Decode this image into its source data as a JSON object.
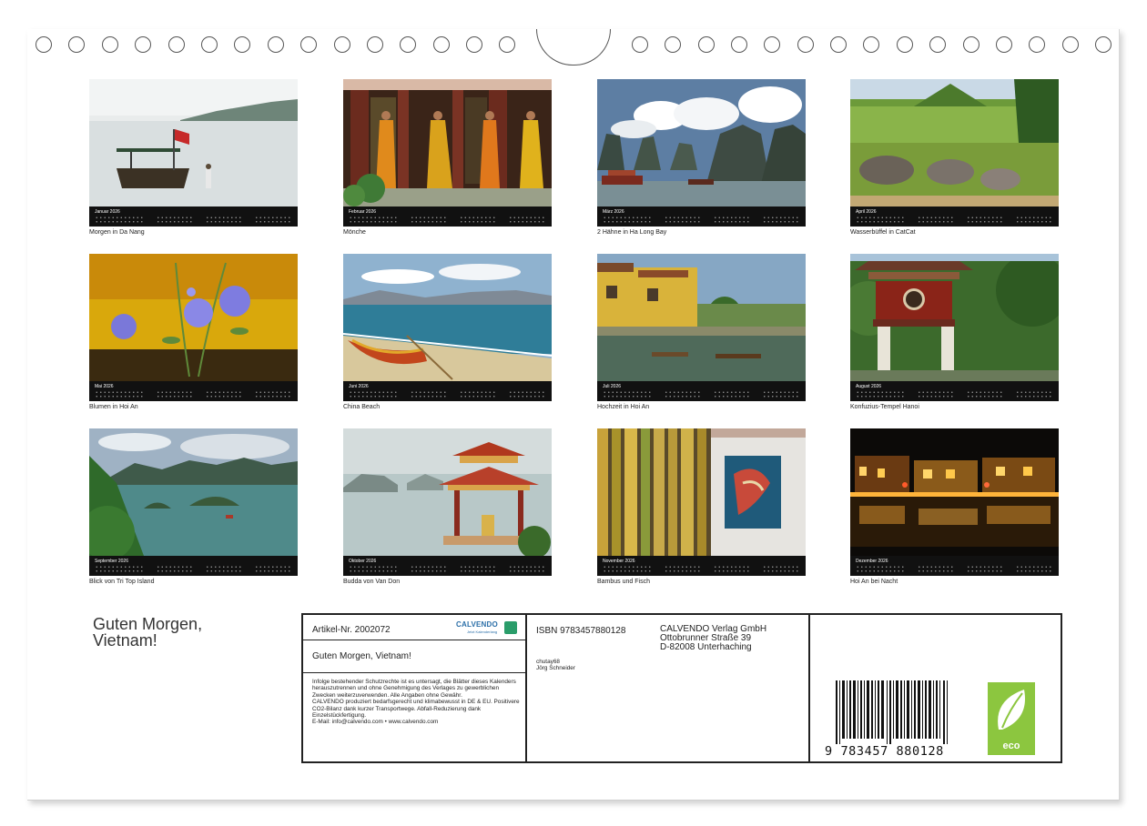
{
  "calendar": {
    "title": "Guten Morgen,\nVietnam!",
    "months": [
      {
        "name": "Januar 2026",
        "caption": "Morgen in Da Nang"
      },
      {
        "name": "Februar 2026",
        "caption": "Mönche"
      },
      {
        "name": "März 2026",
        "caption": "2 Hähne in Ha Long Bay"
      },
      {
        "name": "April 2026",
        "caption": "Wasserbüffel in CatCat"
      },
      {
        "name": "Mai 2026",
        "caption": "Blumen in Hoi An"
      },
      {
        "name": "Juni 2026",
        "caption": "China Beach"
      },
      {
        "name": "Juli 2026",
        "caption": "Hochzeit in Hoi An"
      },
      {
        "name": "August 2026",
        "caption": "Konfuzius-Tempel Hanoi"
      },
      {
        "name": "September 2026",
        "caption": "Blick von Tri Top Island"
      },
      {
        "name": "Oktober 2026",
        "caption": "Budda von Van Don"
      },
      {
        "name": "November 2026",
        "caption": "Bambus und Fisch"
      },
      {
        "name": "Dezember 2026",
        "caption": "Hoi An bei Nacht"
      }
    ]
  },
  "imprint": {
    "article_number": "Artikel-Nr. 2002072",
    "logo_text": "CALVENDO",
    "logo_subtext": "Jetzt Kalenderlang",
    "subtitle": "Guten Morgen, Vietnam!",
    "legal_text": "Infolge bestehender Schutzrechte ist es untersagt, die Blätter dieses Kalenders herauszutrennen und ohne Genehmigung des Verlages zu gewerblichen Zwecken weiterzuverwenden. Alle Angaben ohne Gewähr.\nCALVENDO produziert bedarfsgerecht und klimabewusst in DE & EU. Positivere CO2-Bilanz dank kurzer Transportwege. Abfall-Reduzierung dank Einzelstückfertigung.\nE-Mail: info@calvendo.com • www.calvendo.com",
    "isbn": "ISBN 9783457880128",
    "publisher": "CALVENDO Verlag GmbH\nOttobrunner Straße 39\nD-82008 Unterhaching",
    "author": "chutay68\nJörg Schneider",
    "barcode_number": "9 783457 880128",
    "eco_label": "eco"
  },
  "colors": {
    "calendar_bar": "#111111",
    "eco_green": "#8cc63f",
    "calvendo_blue": "#2b6fa8"
  }
}
